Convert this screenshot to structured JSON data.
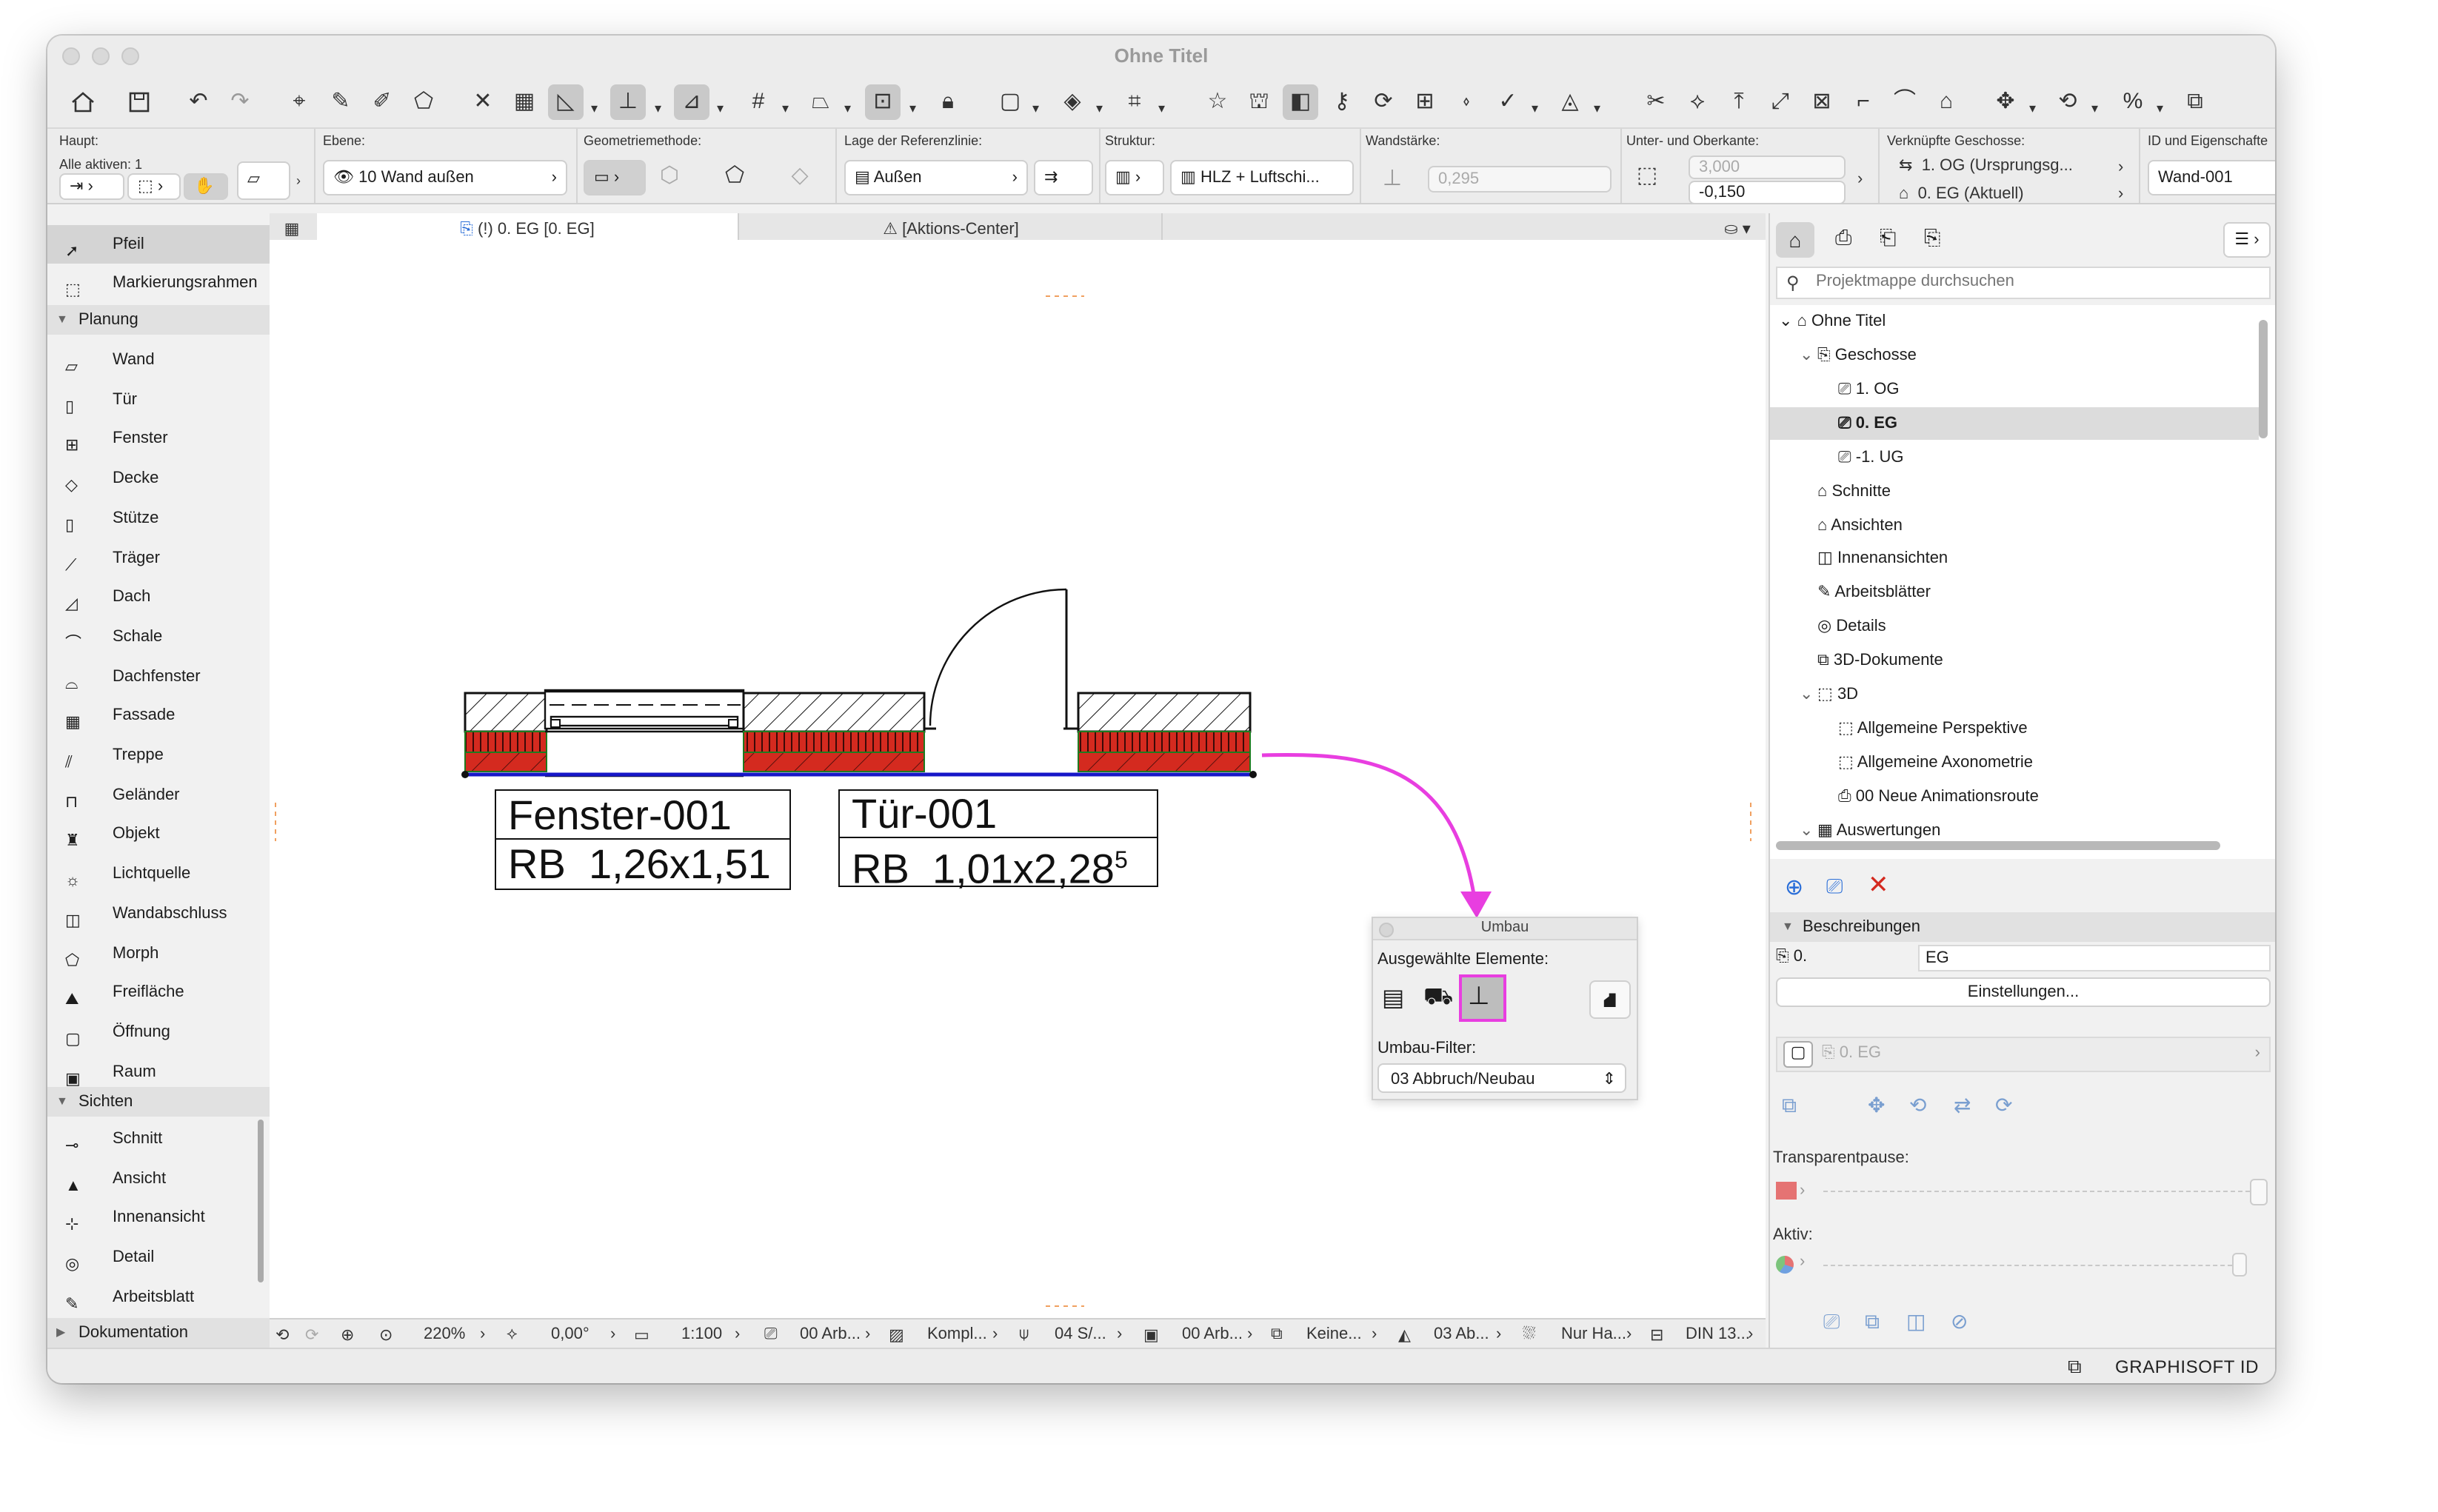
{
  "window": {
    "title": "Ohne Titel"
  },
  "infobox": {
    "haupt_label": "Haupt:",
    "alle_aktiven_label": "Alle aktiven: 1",
    "ebene_label": "Ebene:",
    "ebene_value": "10 Wand außen",
    "geometrie_label": "Geometriemethode:",
    "referenz_label": "Lage der Referenzlinie:",
    "referenz_value": "Außen",
    "struktur_label": "Struktur:",
    "struktur_value": "HLZ + Luftschi...",
    "wandstaerke_label": "Wandstärke:",
    "wandstaerke_value": "0,295",
    "unter_ober_label": "Unter- und Oberkante:",
    "oberkante_value": "3,000",
    "unterkante_value": "-0,150",
    "verknuepfte_label": "Verknüpfte Geschosse:",
    "verknuepfte_top": "1. OG (Ursprungsg...",
    "verknuepfte_bottom": "0. EG (Aktuell)",
    "id_label": "ID und Eigenschafte",
    "id_value": "Wand-001"
  },
  "tabs": {
    "plan": "(!) 0. EG [0. EG]",
    "action": "[Aktions-Center]"
  },
  "toolbox": {
    "top": [
      {
        "label": "Pfeil"
      },
      {
        "label": "Markierungsrahmen"
      }
    ],
    "planung_header": "Planung",
    "planung": [
      {
        "label": "Wand"
      },
      {
        "label": "Tür"
      },
      {
        "label": "Fenster"
      },
      {
        "label": "Decke"
      },
      {
        "label": "Stütze"
      },
      {
        "label": "Träger"
      },
      {
        "label": "Dach"
      },
      {
        "label": "Schale"
      },
      {
        "label": "Dachfenster"
      },
      {
        "label": "Fassade"
      },
      {
        "label": "Treppe"
      },
      {
        "label": "Geländer"
      },
      {
        "label": "Objekt"
      },
      {
        "label": "Lichtquelle"
      },
      {
        "label": "Wandabschluss"
      },
      {
        "label": "Morph"
      },
      {
        "label": "Freifläche"
      },
      {
        "label": "Öffnung"
      },
      {
        "label": "Raum"
      }
    ],
    "sichten_header": "Sichten",
    "sichten": [
      {
        "label": "Schnitt"
      },
      {
        "label": "Ansicht"
      },
      {
        "label": "Innenansicht"
      },
      {
        "label": "Detail"
      },
      {
        "label": "Arbeitsblatt"
      }
    ],
    "dokumentation_header": "Dokumentation"
  },
  "drawing": {
    "window_tag": {
      "id": "Fenster-001",
      "rb": "RB",
      "dims": "1,26x1,51"
    },
    "door_tag": {
      "id": "Tür-001",
      "rb": "RB",
      "dims": "1,01x2,28",
      "sup": "5"
    }
  },
  "umbau": {
    "title": "Umbau",
    "selected_label": "Ausgewählte Elemente:",
    "filter_label": "Umbau-Filter:",
    "filter_value": "03 Abbruch/Neubau"
  },
  "statusbar": {
    "zoom": "220%",
    "angle": "0,00°",
    "scale": "1:100",
    "layer_combo": "00 Arb...",
    "structure": "Kompl...",
    "pen": "04 S/...",
    "model_view": "00 Arb...",
    "override": "Keine...",
    "renovation": "03 Ab...",
    "structure_display": "Nur Ha...",
    "dimension": "DIN 13..."
  },
  "navigator": {
    "search_placeholder": "Projektmappe durchsuchen",
    "root": "Ohne Titel",
    "items": [
      {
        "label": "Geschosse"
      },
      {
        "label": "1. OG"
      },
      {
        "label": "0. EG"
      },
      {
        "label": "-1. UG"
      },
      {
        "label": "Schnitte"
      },
      {
        "label": "Ansichten"
      },
      {
        "label": "Innenansichten"
      },
      {
        "label": "Arbeitsblätter"
      },
      {
        "label": "Details"
      },
      {
        "label": "3D-Dokumente"
      },
      {
        "label": "3D"
      },
      {
        "label": "Allgemeine Perspektive"
      },
      {
        "label": "Allgemeine Axonometrie"
      },
      {
        "label": "00 Neue Animationsroute"
      },
      {
        "label": "Auswertungen"
      }
    ],
    "beschreibungen_header": "Beschreibungen",
    "desc_num": "0.",
    "desc_name": "EG",
    "settings_button": "Einstellungen...",
    "linked_view": "0. EG",
    "transparent_label": "Transparentpause:",
    "aktiv_label": "Aktiv:"
  },
  "footer": {
    "brand": "GRAPHISOFT ID"
  },
  "colors": {
    "accent_magenta": "#e83ee0",
    "wall_red": "#d42a1f",
    "wall_blue": "#1717c8",
    "wall_green": "#1f7a1f"
  }
}
